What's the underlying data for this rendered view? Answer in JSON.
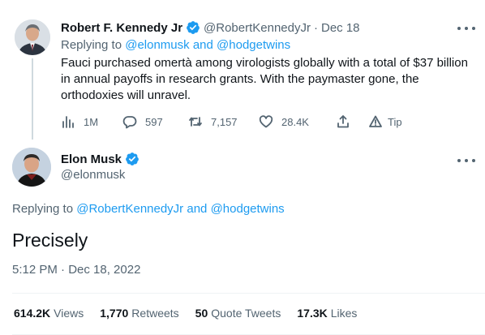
{
  "parent_tweet": {
    "name": "Robert F. Kennedy Jr",
    "handle": "@RobertKennedyJr",
    "separator": "·",
    "date": "Dec 18",
    "replying_prefix": "Replying to",
    "replying_user1": "@elonmusk",
    "replying_and": "and",
    "replying_user2": "@hodgetwins",
    "text": "Fauci purchased omertà among virologists globally with a total of $37 billion in annual payoffs in research grants. With the paymaster gone, the orthodoxies will unravel.",
    "actions": {
      "views_icon": "bar-chart-icon",
      "views": "1M",
      "reply_icon": "speech-bubble-icon",
      "replies": "597",
      "retweet_icon": "retweet-arrows-icon",
      "retweets": "7,157",
      "like_icon": "heart-icon",
      "likes": "28.4K",
      "share_icon": "share-upload-icon",
      "tip_icon": "tip-triangle-icon",
      "tip_label": "Tip"
    }
  },
  "main_tweet": {
    "name": "Elon Musk",
    "handle": "@elonmusk",
    "replying_prefix": "Replying to",
    "replying_user1": "@RobertKennedyJr",
    "replying_and": "and",
    "replying_user2": "@hodgetwins",
    "text": "Precisely",
    "timestamp": "5:12 PM · Dec 18, 2022",
    "stats": {
      "views_count": "614.2K",
      "views_label": "Views",
      "retweets_count": "1,770",
      "retweets_label": "Retweets",
      "quotes_count": "50",
      "quotes_label": "Quote Tweets",
      "likes_count": "17.3K",
      "likes_label": "Likes"
    }
  },
  "colors": {
    "link": "#1d9bf0",
    "verified": "#1d9bf0",
    "muted": "#536471",
    "text": "#0f1419"
  }
}
